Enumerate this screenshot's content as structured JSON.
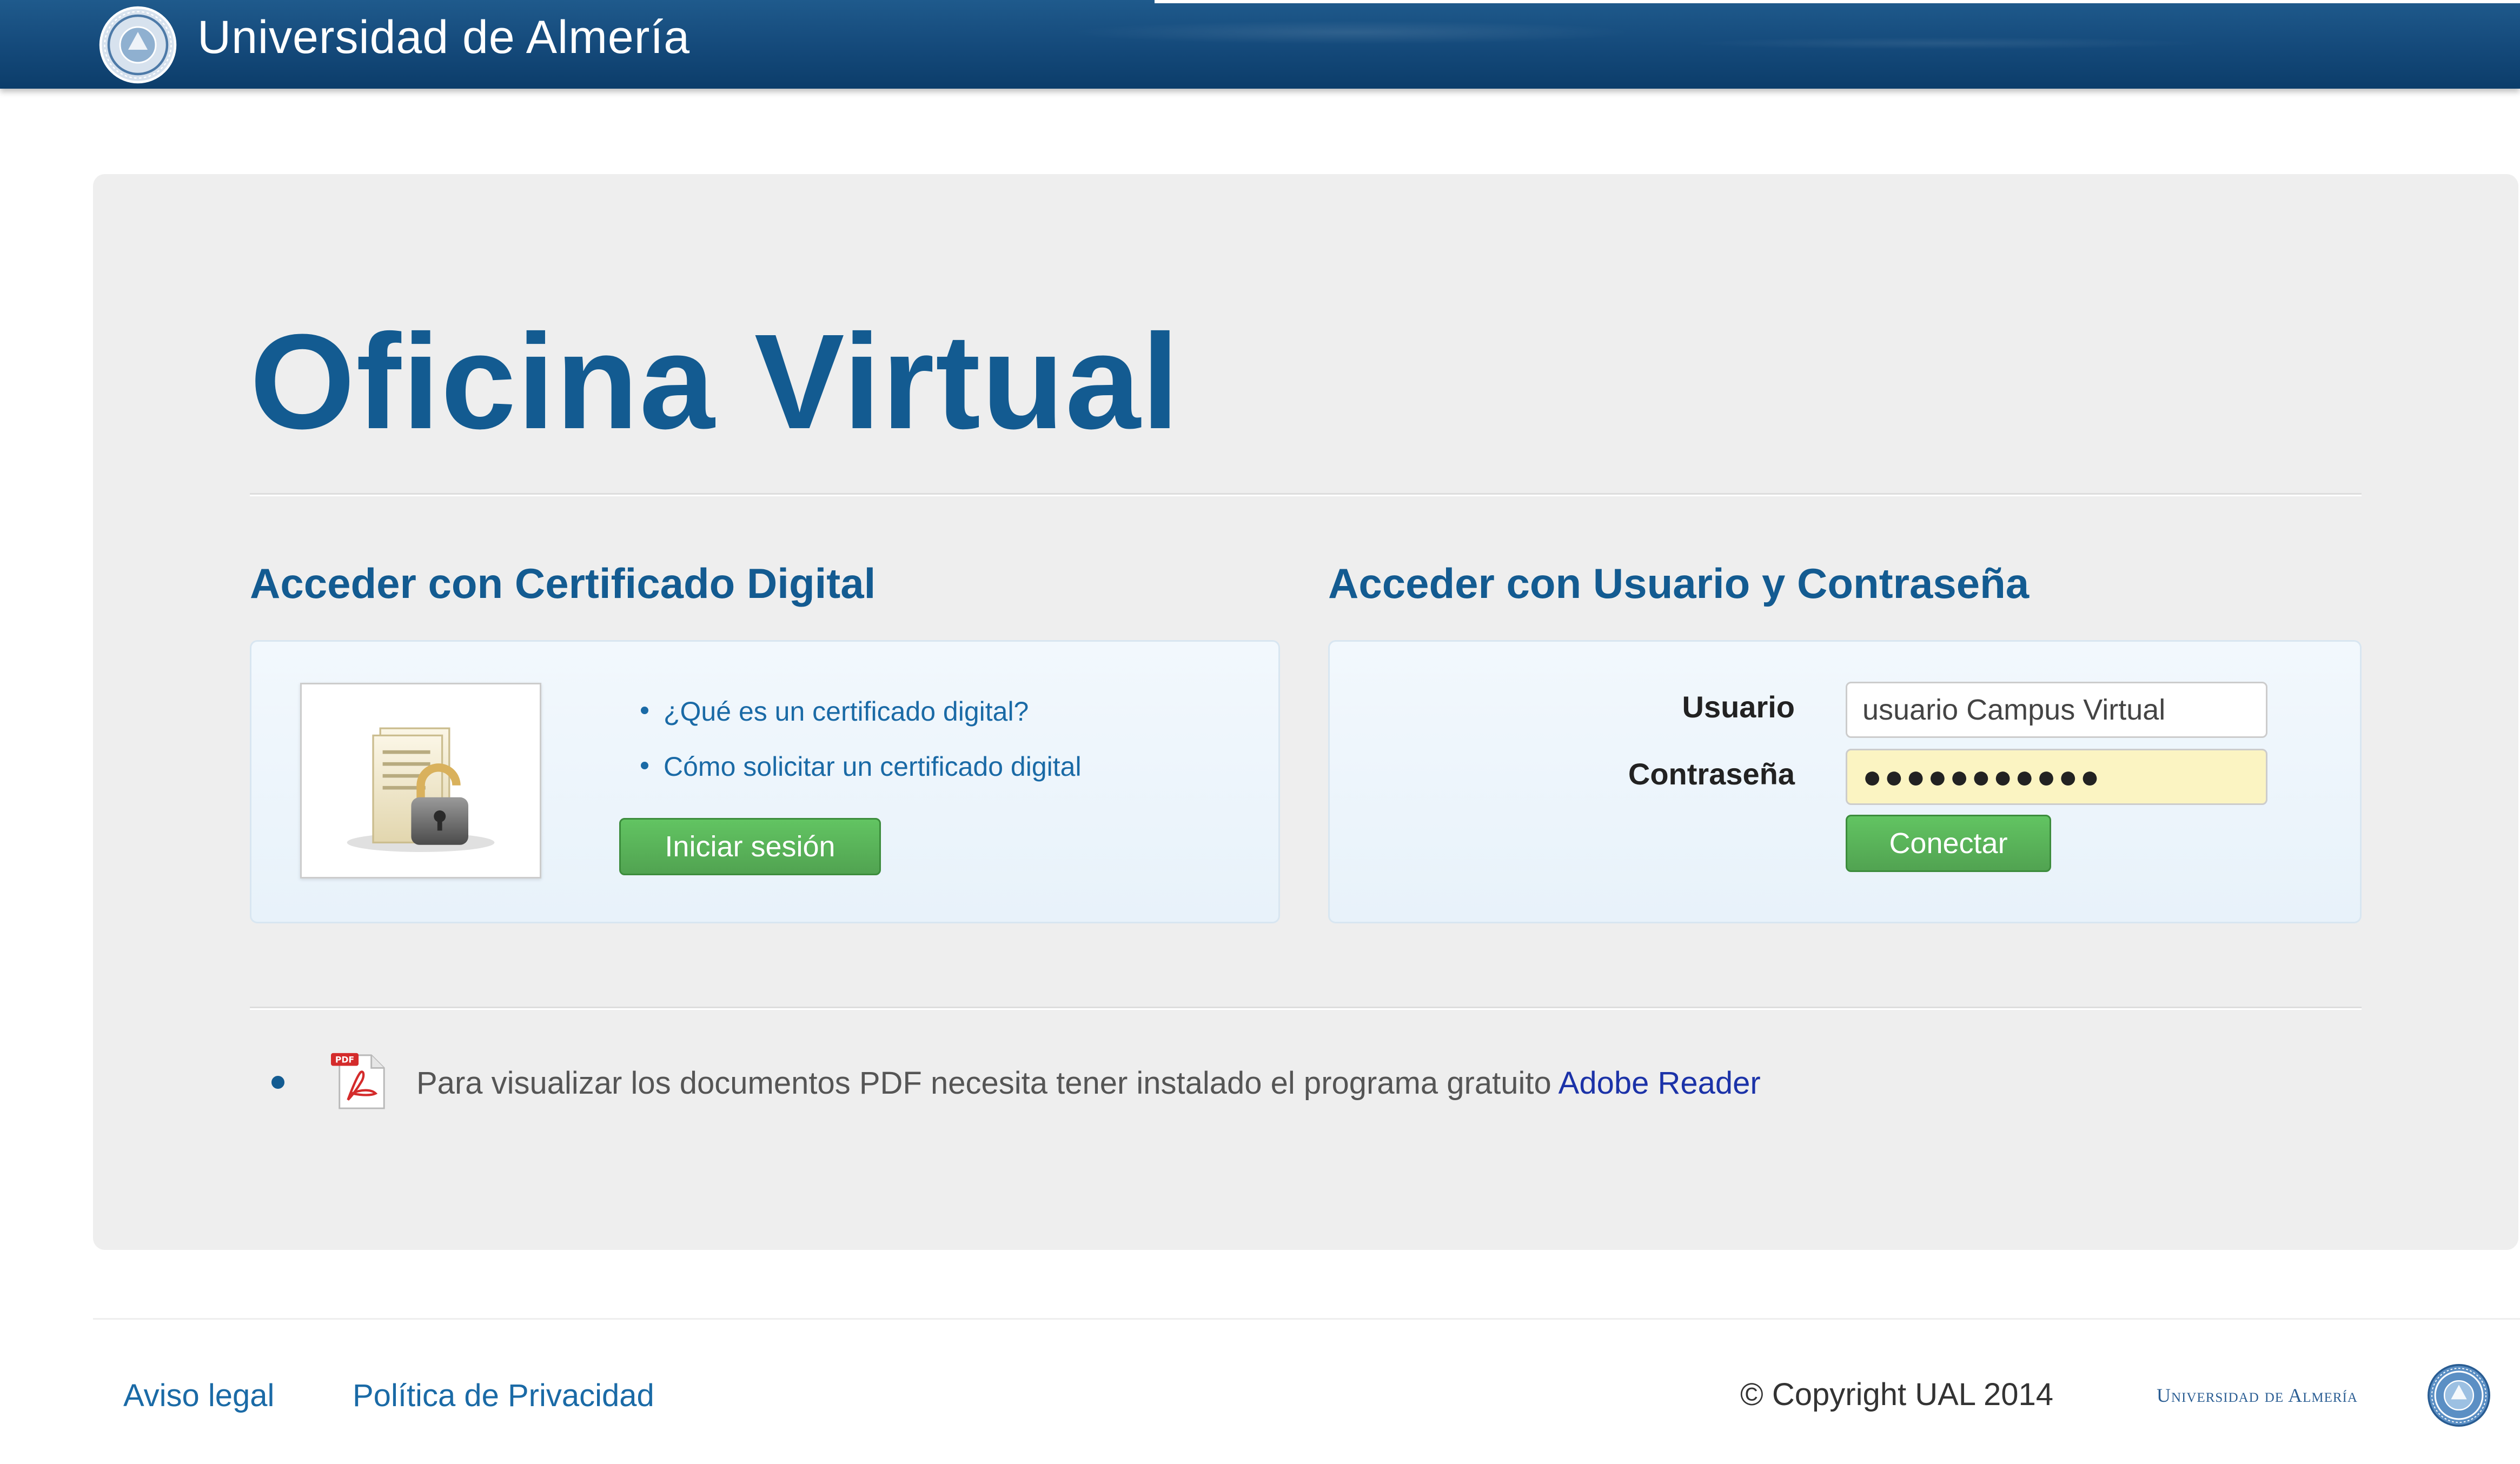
{
  "header": {
    "brand_name": "Universidad de Almería",
    "logo_icon": "university-seal-icon"
  },
  "main": {
    "title": "Oficina Virtual",
    "certificate": {
      "heading": "Acceder con Certificado Digital",
      "image_icon": "certificate-lock-icon",
      "links": [
        "¿Qué es un certificado digital?",
        "Cómo solicitar un certificado digital"
      ],
      "login_button": "Iniciar sesión"
    },
    "credentials": {
      "heading": "Acceder con Usuario y Contraseña",
      "username_label": "Usuario",
      "username_value": "usuario Campus Virtual",
      "password_label": "Contraseña",
      "password_value": "●●●●●●●●●●●",
      "connect_button": "Conectar"
    },
    "pdf_note": {
      "icon": "pdf-file-icon",
      "text": "Para visualizar los documentos PDF necesita tener instalado el programa gratuito",
      "link": "Adobe Reader"
    }
  },
  "footer": {
    "links": [
      "Aviso legal",
      "Política de Privacidad"
    ],
    "copyright": "© Copyright UAL 2014",
    "brand": "Universidad de Almería"
  },
  "colors": {
    "header_blue": "#14497a",
    "title_blue": "#135b91",
    "link_blue": "#1a6aa6",
    "button_green": "#51a351",
    "panel_gray": "#eeeeee",
    "password_bg": "#fbf4c2"
  }
}
